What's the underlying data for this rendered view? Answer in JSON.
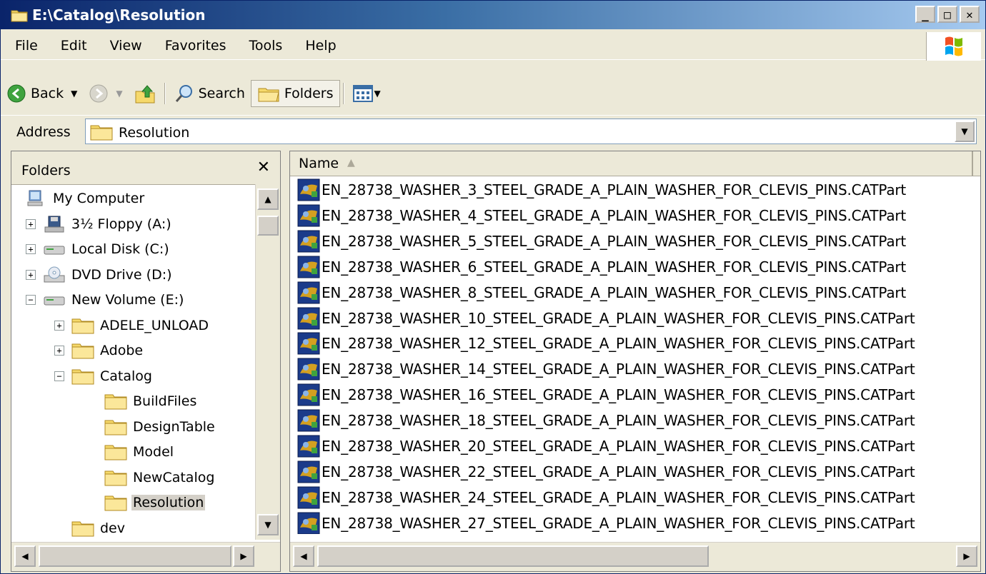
{
  "window": {
    "title": "E:\\Catalog\\Resolution",
    "min_label": "_",
    "max_label": "□",
    "close_label": "✕"
  },
  "menu": [
    "File",
    "Edit",
    "View",
    "Favorites",
    "Tools",
    "Help"
  ],
  "toolbar": {
    "back_label": "Back",
    "search_label": "Search",
    "folders_label": "Folders"
  },
  "address": {
    "label": "Address",
    "value": "Resolution"
  },
  "folders_pane": {
    "title": "Folders",
    "close_label": "✕",
    "tree": [
      {
        "label": "My Computer",
        "depth": 0,
        "toggle": "",
        "icon": "computer-icon"
      },
      {
        "label": "3½ Floppy (A:)",
        "depth": 1,
        "toggle": "+",
        "icon": "floppy-icon"
      },
      {
        "label": "Local Disk (C:)",
        "depth": 1,
        "toggle": "+",
        "icon": "disk-icon"
      },
      {
        "label": "DVD Drive (D:)",
        "depth": 1,
        "toggle": "+",
        "icon": "dvd-icon"
      },
      {
        "label": "New Volume (E:)",
        "depth": 1,
        "toggle": "−",
        "icon": "disk-icon"
      },
      {
        "label": "ADELE_UNLOAD",
        "depth": 2,
        "toggle": "+",
        "icon": "folder-icon"
      },
      {
        "label": "Adobe",
        "depth": 2,
        "toggle": "+",
        "icon": "folder-icon"
      },
      {
        "label": "Catalog",
        "depth": 2,
        "toggle": "−",
        "icon": "folder-icon"
      },
      {
        "label": "BuildFiles",
        "depth": 3,
        "toggle": "",
        "icon": "folder-icon"
      },
      {
        "label": "DesignTable",
        "depth": 3,
        "toggle": "",
        "icon": "folder-icon"
      },
      {
        "label": "Model",
        "depth": 3,
        "toggle": "",
        "icon": "folder-icon"
      },
      {
        "label": "NewCatalog",
        "depth": 3,
        "toggle": "",
        "icon": "folder-icon"
      },
      {
        "label": "Resolution",
        "depth": 3,
        "toggle": "",
        "icon": "folder-icon",
        "selected": true
      },
      {
        "label": "dev",
        "depth": 2,
        "toggle": "",
        "icon": "folder-icon"
      }
    ]
  },
  "file_list": {
    "column": "Name",
    "files": [
      "EN_28738_WASHER_3_STEEL_GRADE_A_PLAIN_WASHER_FOR_CLEVIS_PINS.CATPart",
      "EN_28738_WASHER_4_STEEL_GRADE_A_PLAIN_WASHER_FOR_CLEVIS_PINS.CATPart",
      "EN_28738_WASHER_5_STEEL_GRADE_A_PLAIN_WASHER_FOR_CLEVIS_PINS.CATPart",
      "EN_28738_WASHER_6_STEEL_GRADE_A_PLAIN_WASHER_FOR_CLEVIS_PINS.CATPart",
      "EN_28738_WASHER_8_STEEL_GRADE_A_PLAIN_WASHER_FOR_CLEVIS_PINS.CATPart",
      "EN_28738_WASHER_10_STEEL_GRADE_A_PLAIN_WASHER_FOR_CLEVIS_PINS.CATPart",
      "EN_28738_WASHER_12_STEEL_GRADE_A_PLAIN_WASHER_FOR_CLEVIS_PINS.CATPart",
      "EN_28738_WASHER_14_STEEL_GRADE_A_PLAIN_WASHER_FOR_CLEVIS_PINS.CATPart",
      "EN_28738_WASHER_16_STEEL_GRADE_A_PLAIN_WASHER_FOR_CLEVIS_PINS.CATPart",
      "EN_28738_WASHER_18_STEEL_GRADE_A_PLAIN_WASHER_FOR_CLEVIS_PINS.CATPart",
      "EN_28738_WASHER_20_STEEL_GRADE_A_PLAIN_WASHER_FOR_CLEVIS_PINS.CATPart",
      "EN_28738_WASHER_22_STEEL_GRADE_A_PLAIN_WASHER_FOR_CLEVIS_PINS.CATPart",
      "EN_28738_WASHER_24_STEEL_GRADE_A_PLAIN_WASHER_FOR_CLEVIS_PINS.CATPart",
      "EN_28738_WASHER_27_STEEL_GRADE_A_PLAIN_WASHER_FOR_CLEVIS_PINS.CATPart"
    ]
  },
  "colors": {
    "title_start": "#0a246a",
    "title_end": "#a6caf0",
    "chrome": "#ece9d8",
    "folder": "#f6d96b",
    "selection": "#d4d0c8"
  }
}
